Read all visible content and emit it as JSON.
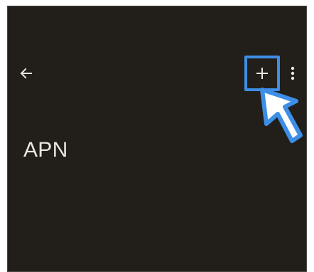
{
  "app_bar": {
    "back_icon": "arrow-left-icon",
    "add_icon": "plus-icon",
    "more_icon": "more-vert-icon"
  },
  "page": {
    "title": "APN"
  },
  "annotation": {
    "highlight_color": "#3d8ee6",
    "pointer_icon": "cursor-arrow-icon"
  },
  "colors": {
    "background": "#221f1b",
    "foreground": "#ece6e1",
    "accent": "#3d8ee6"
  }
}
